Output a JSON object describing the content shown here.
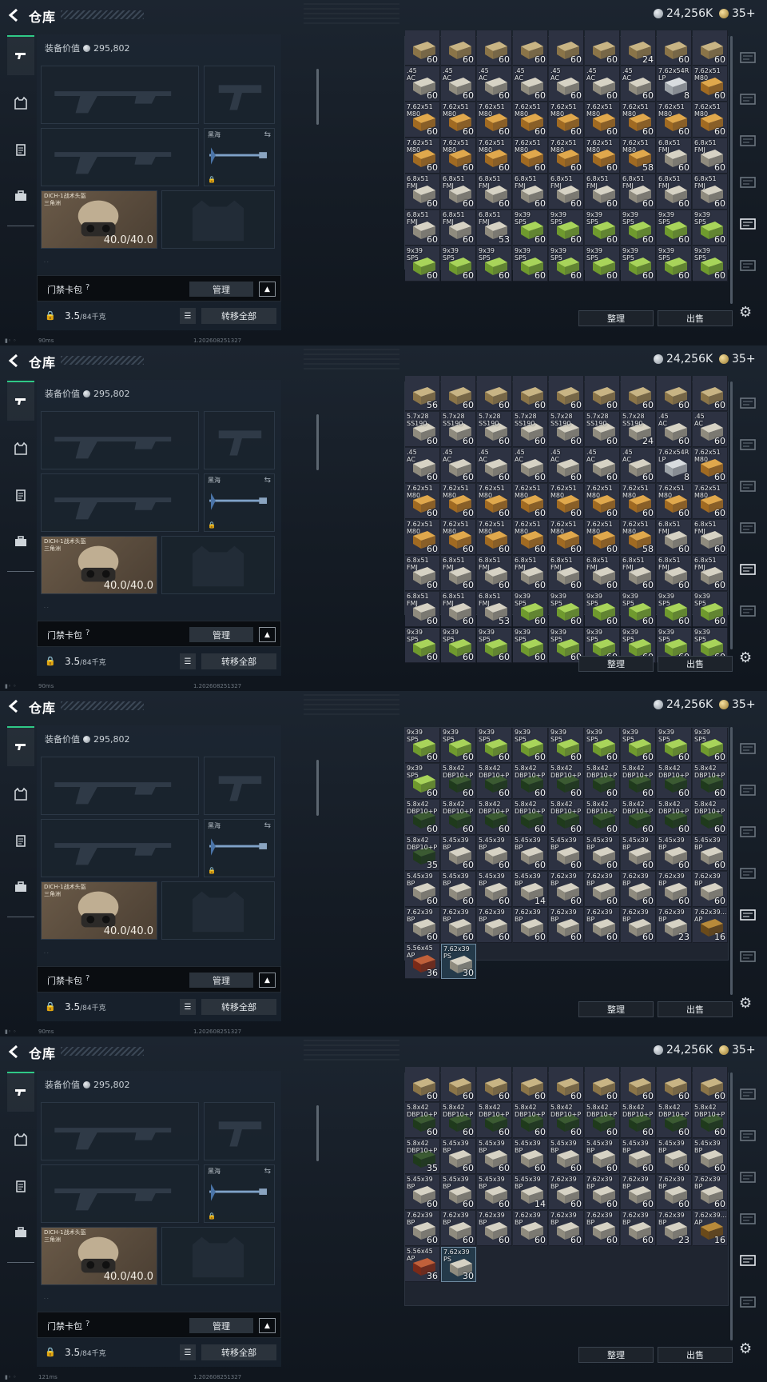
{
  "app": {
    "title": "仓库",
    "currency_silver": "24,256K",
    "currency_gold": "35+"
  },
  "colors": {
    "accent": "#2fc987",
    "panel": "#1e2834"
  },
  "nav": [
    {
      "name": "weapons",
      "icon": "gun-icon",
      "active": true
    },
    {
      "name": "armor",
      "icon": "vest-icon"
    },
    {
      "name": "chest-rig",
      "icon": "clipboard-icon"
    },
    {
      "name": "backpack",
      "icon": "briefcase-icon"
    }
  ],
  "equipment": {
    "value_label": "装备价值",
    "value": "295,802",
    "melee_label": "黑海",
    "helmet_name": "DICH-1战术头盔",
    "helmet_sub": "三角洲",
    "helmet_durability": "40.0/40.0",
    "key_label": "门禁卡包",
    "help": "?",
    "manage": "管理",
    "weight": "3.5",
    "weight_max": "/84千克",
    "transfer_all": "转移全部"
  },
  "status": {
    "ping": [
      "90ms",
      "90ms",
      "90ms",
      "121ms"
    ],
    "build": "1.202608251327"
  },
  "actions": {
    "sort": "整理",
    "sell": "出售"
  },
  "frames": [
    {
      "rows": [
        [
          [
            "",
            "60"
          ],
          [
            "",
            "60"
          ],
          [
            "",
            "60"
          ],
          [
            "",
            "60"
          ],
          [
            "",
            "60"
          ],
          [
            "",
            "60"
          ],
          [
            "",
            "24"
          ],
          [
            "",
            "60"
          ],
          [
            "",
            "60"
          ]
        ],
        [
          [
            ".45\nAC",
            "60"
          ],
          [
            ".45\nAC",
            "60"
          ],
          [
            ".45\nAC",
            "60"
          ],
          [
            ".45\nAC",
            "60"
          ],
          [
            ".45\nAC",
            "60"
          ],
          [
            ".45\nAC",
            "60"
          ],
          [
            ".45\nAC",
            "60"
          ],
          [
            "7.62x54R\nLP",
            "8"
          ],
          [
            "7.62x51\nM80",
            "60"
          ]
        ],
        [
          [
            "7.62x51\nM80",
            "60"
          ],
          [
            "7.62x51\nM80",
            "60"
          ],
          [
            "7.62x51\nM80",
            "60"
          ],
          [
            "7.62x51\nM80",
            "60"
          ],
          [
            "7.62x51\nM80",
            "60"
          ],
          [
            "7.62x51\nM80",
            "60"
          ],
          [
            "7.62x51\nM80",
            "60"
          ],
          [
            "7.62x51\nM80",
            "60"
          ],
          [
            "7.62x51\nM80",
            "60"
          ]
        ],
        [
          [
            "7.62x51\nM80",
            "60"
          ],
          [
            "7.62x51\nM80",
            "60"
          ],
          [
            "7.62x51\nM80",
            "60"
          ],
          [
            "7.62x51\nM80",
            "60"
          ],
          [
            "7.62x51\nM80",
            "60"
          ],
          [
            "7.62x51\nM80",
            "60"
          ],
          [
            "7.62x51\nM80",
            "58"
          ],
          [
            "6.8x51\nFMJ",
            "60"
          ],
          [
            "6.8x51\nFMJ",
            "60"
          ]
        ],
        [
          [
            "6.8x51\nFMJ",
            "60"
          ],
          [
            "6.8x51\nFMJ",
            "60"
          ],
          [
            "6.8x51\nFMJ",
            "60"
          ],
          [
            "6.8x51\nFMJ",
            "60"
          ],
          [
            "6.8x51\nFMJ",
            "60"
          ],
          [
            "6.8x51\nFMJ",
            "60"
          ],
          [
            "6.8x51\nFMJ",
            "60"
          ],
          [
            "6.8x51\nFMJ",
            "60"
          ],
          [
            "6.8x51\nFMJ",
            "60"
          ]
        ],
        [
          [
            "6.8x51\nFMJ",
            "60"
          ],
          [
            "6.8x51\nFMJ",
            "60"
          ],
          [
            "6.8x51\nFMJ",
            "53"
          ],
          [
            "9x39\nSP5",
            "60"
          ],
          [
            "9x39\nSP5",
            "60"
          ],
          [
            "9x39\nSP5",
            "60"
          ],
          [
            "9x39\nSP5",
            "60"
          ],
          [
            "9x39\nSP5",
            "60"
          ],
          [
            "9x39\nSP5",
            "60"
          ]
        ],
        [
          [
            "9x39\nSP5",
            "60"
          ],
          [
            "9x39\nSP5",
            "60"
          ],
          [
            "9x39\nSP5",
            "60"
          ],
          [
            "9x39\nSP5",
            "60"
          ],
          [
            "9x39\nSP5",
            "60"
          ],
          [
            "9x39\nSP5",
            "60"
          ],
          [
            "9x39\nSP5",
            "60"
          ],
          [
            "9x39\nSP5",
            "60"
          ],
          [
            "9x39\nSP5",
            "60"
          ]
        ]
      ]
    },
    {
      "rows": [
        [
          [
            "",
            "56"
          ],
          [
            "",
            "60"
          ],
          [
            "",
            "60"
          ],
          [
            "",
            "60"
          ],
          [
            "",
            "60"
          ],
          [
            "",
            "60"
          ],
          [
            "",
            "60"
          ],
          [
            "",
            "60"
          ],
          [
            "",
            "60"
          ]
        ],
        [
          [
            "5.7x28\nSS190",
            "60"
          ],
          [
            "5.7x28\nSS190",
            "60"
          ],
          [
            "5.7x28\nSS190",
            "60"
          ],
          [
            "5.7x28\nSS190",
            "60"
          ],
          [
            "5.7x28\nSS190",
            "60"
          ],
          [
            "5.7x28\nSS190",
            "60"
          ],
          [
            "5.7x28\nSS190",
            "24"
          ],
          [
            ".45\nAC",
            "60"
          ],
          [
            ".45\nAC",
            "60"
          ]
        ],
        [
          [
            ".45\nAC",
            "60"
          ],
          [
            ".45\nAC",
            "60"
          ],
          [
            ".45\nAC",
            "60"
          ],
          [
            ".45\nAC",
            "60"
          ],
          [
            ".45\nAC",
            "60"
          ],
          [
            ".45\nAC",
            "60"
          ],
          [
            ".45\nAC",
            "60"
          ],
          [
            "7.62x54R\nLP",
            "8"
          ],
          [
            "7.62x51\nM80",
            "60"
          ]
        ],
        [
          [
            "7.62x51\nM80",
            "60"
          ],
          [
            "7.62x51\nM80",
            "60"
          ],
          [
            "7.62x51\nM80",
            "60"
          ],
          [
            "7.62x51\nM80",
            "60"
          ],
          [
            "7.62x51\nM80",
            "60"
          ],
          [
            "7.62x51\nM80",
            "60"
          ],
          [
            "7.62x51\nM80",
            "60"
          ],
          [
            "7.62x51\nM80",
            "60"
          ],
          [
            "7.62x51\nM80",
            "60"
          ]
        ],
        [
          [
            "7.62x51\nM80",
            "60"
          ],
          [
            "7.62x51\nM80",
            "60"
          ],
          [
            "7.62x51\nM80",
            "60"
          ],
          [
            "7.62x51\nM80",
            "60"
          ],
          [
            "7.62x51\nM80",
            "60"
          ],
          [
            "7.62x51\nM80",
            "60"
          ],
          [
            "7.62x51\nM80",
            "58"
          ],
          [
            "6.8x51\nFMJ",
            "60"
          ],
          [
            "6.8x51\nFMJ",
            "60"
          ]
        ],
        [
          [
            "6.8x51\nFMJ",
            "60"
          ],
          [
            "6.8x51\nFMJ",
            "60"
          ],
          [
            "6.8x51\nFMJ",
            "60"
          ],
          [
            "6.8x51\nFMJ",
            "60"
          ],
          [
            "6.8x51\nFMJ",
            "60"
          ],
          [
            "6.8x51\nFMJ",
            "60"
          ],
          [
            "6.8x51\nFMJ",
            "60"
          ],
          [
            "6.8x51\nFMJ",
            "60"
          ],
          [
            "6.8x51\nFMJ",
            "60"
          ]
        ],
        [
          [
            "6.8x51\nFMJ",
            "60"
          ],
          [
            "6.8x51\nFMJ",
            "60"
          ],
          [
            "6.8x51\nFMJ",
            "53"
          ],
          [
            "9x39\nSP5",
            "60"
          ],
          [
            "9x39\nSP5",
            "60"
          ],
          [
            "9x39\nSP5",
            "60"
          ],
          [
            "9x39\nSP5",
            "60"
          ],
          [
            "9x39\nSP5",
            "60"
          ],
          [
            "9x39\nSP5",
            "60"
          ]
        ],
        [
          [
            "9x39\nSP5",
            "60"
          ],
          [
            "9x39\nSP5",
            "60"
          ],
          [
            "9x39\nSP5",
            "60"
          ],
          [
            "9x39\nSP5",
            "60"
          ],
          [
            "9x39\nSP5",
            "60"
          ],
          [
            "9x39\nSP5",
            "60"
          ],
          [
            "9x39\nSP5",
            "60"
          ],
          [
            "9x39\nSP5",
            "60"
          ],
          [
            "9x39\nSP5",
            "60"
          ]
        ]
      ]
    },
    {
      "rows": [
        [
          [
            "9x39\nSP5",
            "60"
          ],
          [
            "9x39\nSP5",
            "60"
          ],
          [
            "9x39\nSP5",
            "60"
          ],
          [
            "9x39\nSP5",
            "60"
          ],
          [
            "9x39\nSP5",
            "60"
          ],
          [
            "9x39\nSP5",
            "60"
          ],
          [
            "9x39\nSP5",
            "60"
          ],
          [
            "9x39\nSP5",
            "60"
          ],
          [
            "9x39\nSP5",
            "60"
          ]
        ],
        [
          [
            "9x39\nSP5",
            "60"
          ],
          [
            "5.8x42\nDBP10+P",
            "60"
          ],
          [
            "5.8x42\nDBP10+P",
            "60"
          ],
          [
            "5.8x42\nDBP10+P",
            "60"
          ],
          [
            "5.8x42\nDBP10+P",
            "60"
          ],
          [
            "5.8x42\nDBP10+P",
            "60"
          ],
          [
            "5.8x42\nDBP10+P",
            "60"
          ],
          [
            "5.8x42\nDBP10+P",
            "60"
          ],
          [
            "5.8x42\nDBP10+P",
            "60"
          ]
        ],
        [
          [
            "5.8x42\nDBP10+P",
            "60"
          ],
          [
            "5.8x42\nDBP10+P",
            "60"
          ],
          [
            "5.8x42\nDBP10+P",
            "60"
          ],
          [
            "5.8x42\nDBP10+P",
            "60"
          ],
          [
            "5.8x42\nDBP10+P",
            "60"
          ],
          [
            "5.8x42\nDBP10+P",
            "60"
          ],
          [
            "5.8x42\nDBP10+P",
            "60"
          ],
          [
            "5.8x42\nDBP10+P",
            "60"
          ],
          [
            "5.8x42\nDBP10+P",
            "60"
          ]
        ],
        [
          [
            "5.8x42\nDBP10+P",
            "35"
          ],
          [
            "5.45x39\nBP",
            "60"
          ],
          [
            "5.45x39\nBP",
            "60"
          ],
          [
            "5.45x39\nBP",
            "60"
          ],
          [
            "5.45x39\nBP",
            "60"
          ],
          [
            "5.45x39\nBP",
            "60"
          ],
          [
            "5.45x39\nBP",
            "60"
          ],
          [
            "5.45x39\nBP",
            "60"
          ],
          [
            "5.45x39\nBP",
            "60"
          ]
        ],
        [
          [
            "5.45x39\nBP",
            "60"
          ],
          [
            "5.45x39\nBP",
            "60"
          ],
          [
            "5.45x39\nBP",
            "60"
          ],
          [
            "5.45x39\nBP",
            "14"
          ],
          [
            "7.62x39\nBP",
            "60"
          ],
          [
            "7.62x39\nBP",
            "60"
          ],
          [
            "7.62x39\nBP",
            "60"
          ],
          [
            "7.62x39\nBP",
            "60"
          ],
          [
            "7.62x39\nBP",
            "60"
          ]
        ],
        [
          [
            "7.62x39\nBP",
            "60"
          ],
          [
            "7.62x39\nBP",
            "60"
          ],
          [
            "7.62x39\nBP",
            "60"
          ],
          [
            "7.62x39\nBP",
            "60"
          ],
          [
            "7.62x39\nBP",
            "60"
          ],
          [
            "7.62x39\nBP",
            "60"
          ],
          [
            "7.62x39\nBP",
            "60"
          ],
          [
            "7.62x39\nBP",
            "23"
          ],
          [
            "7.62x39...\nAP",
            "16"
          ]
        ],
        [
          [
            "5.56x45\nAP",
            "36"
          ],
          [
            "7.62x39\nPS",
            "30"
          ]
        ]
      ]
    },
    {
      "rows": [
        [
          [
            "",
            "60"
          ],
          [
            "",
            "60"
          ],
          [
            "",
            "60"
          ],
          [
            "",
            "60"
          ],
          [
            "",
            "60"
          ],
          [
            "",
            "60"
          ],
          [
            "",
            "60"
          ],
          [
            "",
            "60"
          ],
          [
            "",
            "60"
          ]
        ],
        [
          [
            "5.8x42\nDBP10+P",
            "60"
          ],
          [
            "5.8x42\nDBP10+P",
            "60"
          ],
          [
            "5.8x42\nDBP10+P",
            "60"
          ],
          [
            "5.8x42\nDBP10+P",
            "60"
          ],
          [
            "5.8x42\nDBP10+P",
            "60"
          ],
          [
            "5.8x42\nDBP10+P",
            "60"
          ],
          [
            "5.8x42\nDBP10+P",
            "60"
          ],
          [
            "5.8x42\nDBP10+P",
            "60"
          ],
          [
            "5.8x42\nDBP10+P",
            "60"
          ]
        ],
        [
          [
            "5.8x42\nDBP10+P",
            "35"
          ],
          [
            "5.45x39\nBP",
            "60"
          ],
          [
            "5.45x39\nBP",
            "60"
          ],
          [
            "5.45x39\nBP",
            "60"
          ],
          [
            "5.45x39\nBP",
            "60"
          ],
          [
            "5.45x39\nBP",
            "60"
          ],
          [
            "5.45x39\nBP",
            "60"
          ],
          [
            "5.45x39\nBP",
            "60"
          ],
          [
            "5.45x39\nBP",
            "60"
          ]
        ],
        [
          [
            "5.45x39\nBP",
            "60"
          ],
          [
            "5.45x39\nBP",
            "60"
          ],
          [
            "5.45x39\nBP",
            "60"
          ],
          [
            "5.45x39\nBP",
            "14"
          ],
          [
            "7.62x39\nBP",
            "60"
          ],
          [
            "7.62x39\nBP",
            "60"
          ],
          [
            "7.62x39\nBP",
            "60"
          ],
          [
            "7.62x39\nBP",
            "60"
          ],
          [
            "7.62x39\nBP",
            "60"
          ]
        ],
        [
          [
            "7.62x39\nBP",
            "60"
          ],
          [
            "7.62x39\nBP",
            "60"
          ],
          [
            "7.62x39\nBP",
            "60"
          ],
          [
            "7.62x39\nBP",
            "60"
          ],
          [
            "7.62x39\nBP",
            "60"
          ],
          [
            "7.62x39\nBP",
            "60"
          ],
          [
            "7.62x39\nBP",
            "60"
          ],
          [
            "7.62x39\nBP",
            "23"
          ],
          [
            "7.62x39...\nAP",
            "16"
          ]
        ],
        [
          [
            "5.56x45\nAP",
            "36"
          ],
          [
            "7.62x39\nPS",
            "30"
          ]
        ]
      ]
    }
  ]
}
